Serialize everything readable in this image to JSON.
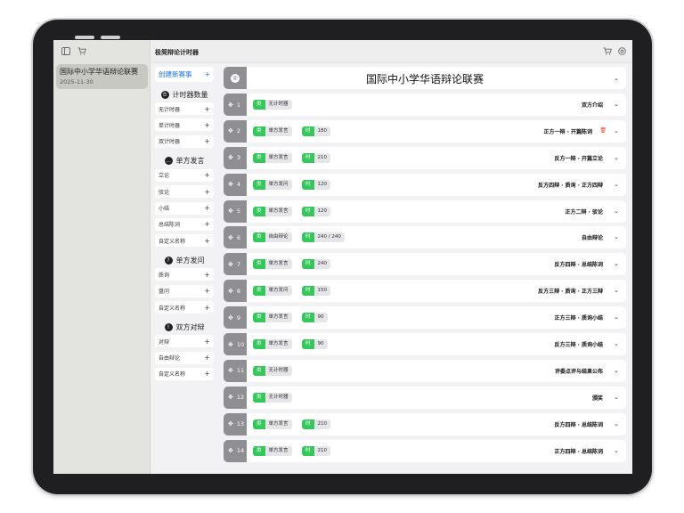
{
  "sidebar": {
    "items": [
      {
        "title": "国际中小学华语辩论联赛",
        "date": "2025-11-30"
      }
    ],
    "icons": [
      "sidebar-toggle-icon",
      "cart-icon"
    ]
  },
  "topbar": {
    "title": "极简辩论计时器",
    "icons": [
      "cart-icon",
      "settings-icon"
    ]
  },
  "left_panel": {
    "new_event": "创建新赛事",
    "sections": [
      {
        "title": "计时器数量",
        "icon": "timer-icon",
        "glyph": "⏱",
        "items": [
          "无计时器",
          "单计时器",
          "双计时器"
        ]
      },
      {
        "title": "单方发言",
        "icon": "speech-bubble-icon",
        "glyph": "…",
        "items": [
          "立论",
          "驳论",
          "小结",
          "总结陈词",
          "自定义名称"
        ]
      },
      {
        "title": "单方发问",
        "icon": "question-icon",
        "glyph": "?",
        "items": [
          "质询",
          "盘问",
          "自定义名称"
        ]
      },
      {
        "title": "双方对辩",
        "icon": "exclamation-icon",
        "glyph": "!",
        "items": [
          "对辩",
          "自由辩论",
          "自定义名称"
        ]
      }
    ]
  },
  "event": {
    "title": "国际中小学华语辩论联赛",
    "type_badge": "类",
    "time_badge": "时",
    "rows": [
      {
        "num": "1",
        "type": "无计时器",
        "time": "",
        "label": "双方介绍"
      },
      {
        "num": "2",
        "type": "单方发言",
        "time": "180",
        "label": "正方一辩 · 开篇陈词",
        "trash": true
      },
      {
        "num": "3",
        "type": "单方发言",
        "time": "210",
        "label": "反方一辩 · 开篇立论"
      },
      {
        "num": "4",
        "type": "单方发问",
        "time": "120",
        "label": "反方四辩 · 质询 · 正方四辩"
      },
      {
        "num": "5",
        "type": "单方发言",
        "time": "120",
        "label": "正方二辩 · 驳论"
      },
      {
        "num": "6",
        "type": "自由辩论",
        "time": "240 / 240",
        "label": "自由辩论"
      },
      {
        "num": "7",
        "type": "单方发言",
        "time": "240",
        "label": "反方四辩 · 总结陈词"
      },
      {
        "num": "8",
        "type": "单方发问",
        "time": "150",
        "label": "反方三辩 · 质询 · 正方三辩"
      },
      {
        "num": "9",
        "type": "单方发言",
        "time": "90",
        "label": "正方三辩 · 质询小结"
      },
      {
        "num": "10",
        "type": "单方发言",
        "time": "90",
        "label": "反方三辩 · 质询小结"
      },
      {
        "num": "11",
        "type": "无计时器",
        "time": "",
        "label": "评委点评与结果公布"
      },
      {
        "num": "12",
        "type": "无计时器",
        "time": "",
        "label": "颁奖"
      },
      {
        "num": "13",
        "type": "单方发言",
        "time": "210",
        "label": "反方四辩 · 总结陈词"
      },
      {
        "num": "14",
        "type": "单方发言",
        "time": "210",
        "label": "正方四辩 · 总结陈词"
      }
    ]
  },
  "colors": {
    "accent_green": "#34c759",
    "accent_blue": "#1a73e8",
    "delete_red": "#ff3b30"
  }
}
